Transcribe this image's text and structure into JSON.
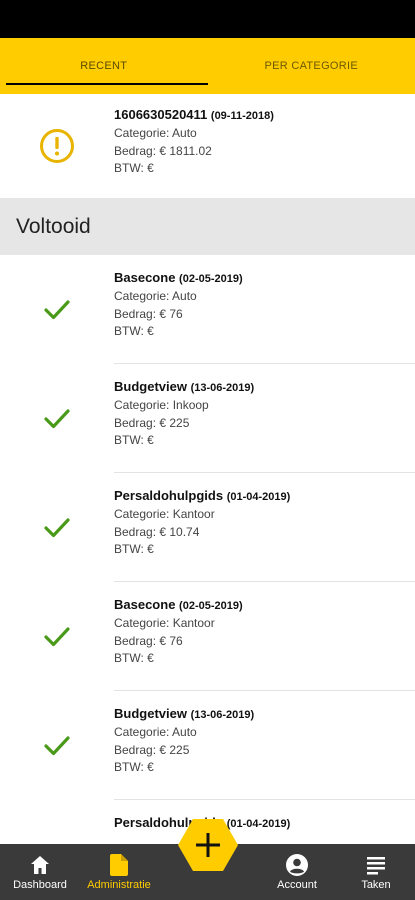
{
  "tabs": {
    "recent": "RECENT",
    "per_categorie": "PER CATEGORIE"
  },
  "pending": {
    "title": "1606630520411",
    "date": "(09-11-2018)",
    "categorie": "Categorie: Auto",
    "bedrag": "Bedrag: € 1811.02",
    "btw": "BTW: €",
    "status_icon": "warning-icon",
    "status_color": "#E8B400"
  },
  "section_title": "Voltooid",
  "completed": [
    {
      "title": "Basecone",
      "date": "(02-05-2019)",
      "categorie": "Categorie: Auto",
      "bedrag": "Bedrag: € 76",
      "btw": "BTW: €"
    },
    {
      "title": "Budgetview",
      "date": "(13-06-2019)",
      "categorie": "Categorie: Inkoop",
      "bedrag": "Bedrag: € 225",
      "btw": "BTW: €"
    },
    {
      "title": "Persaldohulpgids",
      "date": "(01-04-2019)",
      "categorie": "Categorie: Kantoor",
      "bedrag": "Bedrag: € 10.74",
      "btw": "BTW: €"
    },
    {
      "title": "Basecone",
      "date": "(02-05-2019)",
      "categorie": "Categorie: Kantoor",
      "bedrag": "Bedrag: € 76",
      "btw": "BTW: €"
    },
    {
      "title": "Budgetview",
      "date": "(13-06-2019)",
      "categorie": "Categorie: Auto",
      "bedrag": "Bedrag: € 225",
      "btw": "BTW: €"
    },
    {
      "title": "Persaldohulpgids",
      "date": "(01-04-2019)",
      "categorie": "",
      "bedrag": "",
      "btw": ""
    }
  ],
  "check_color": "#4a9a1a",
  "nav": {
    "dashboard": "Dashboard",
    "administratie": "Administratie",
    "account": "Account",
    "taken": "Taken"
  },
  "colors": {
    "accent": "#FFCC00",
    "bottombar": "#3a3a3a"
  }
}
